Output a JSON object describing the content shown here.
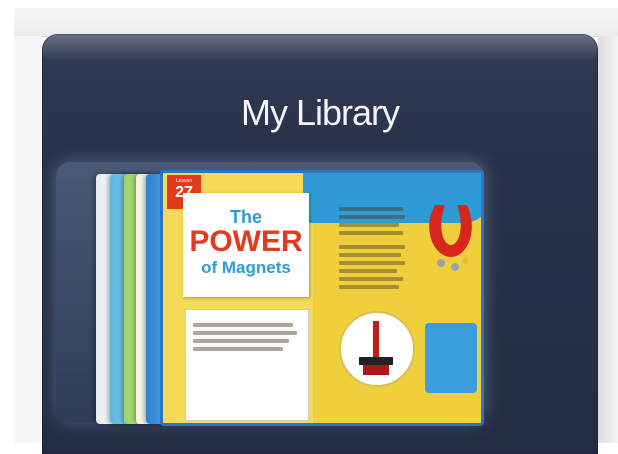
{
  "library": {
    "title": "My Library"
  },
  "book": {
    "lesson_label": "Lesson",
    "lesson_number": "27",
    "title_the": "The",
    "title_power": "POWER",
    "title_magnets": "of Magnets"
  },
  "colors": {
    "panel": "#283349",
    "accent_red": "#e23a1f",
    "accent_blue": "#2f9ad6",
    "page_yellow": "#f2d64a"
  }
}
